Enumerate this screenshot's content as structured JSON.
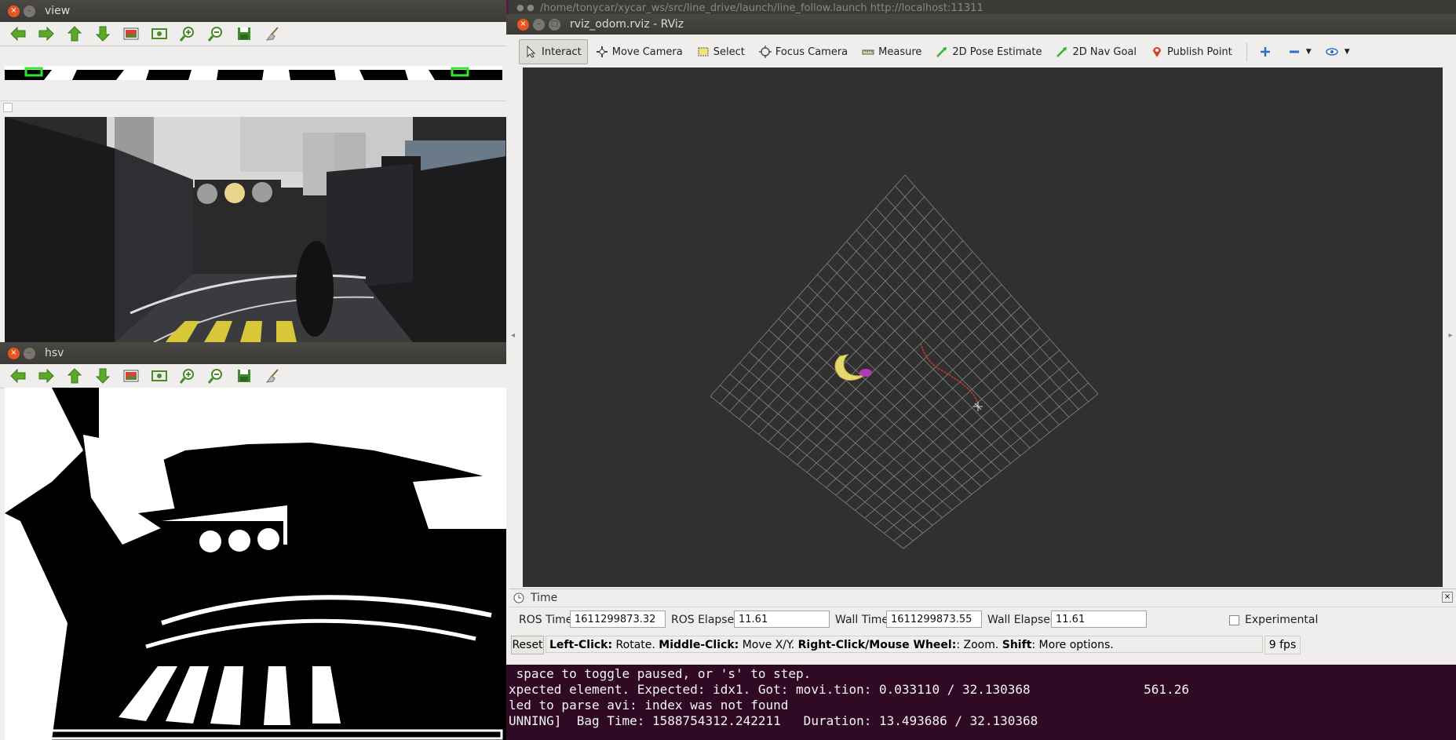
{
  "view_window": {
    "title": "view",
    "toolbar_icons": [
      "arrow-left-icon",
      "arrow-right-icon",
      "arrow-up-icon",
      "arrow-down-icon",
      "image-icon",
      "fit-window-icon",
      "zoom-in-icon",
      "zoom-out-icon",
      "save-icon",
      "clear-icon"
    ]
  },
  "hsv_window": {
    "title": "hsv",
    "toolbar_icons": [
      "arrow-left-icon",
      "arrow-right-icon",
      "arrow-up-icon",
      "arrow-down-icon",
      "image-icon",
      "fit-window-icon",
      "zoom-in-icon",
      "zoom-out-icon",
      "save-icon",
      "clear-icon"
    ]
  },
  "background_window": {
    "title": "/home/tonycar/xycar_ws/src/line_drive/launch/line_follow.launch http://localhost:11311"
  },
  "rviz": {
    "title": "rviz_odom.rviz - RViz",
    "tools": [
      {
        "label": "Interact",
        "icon": "cursor-icon",
        "active": true
      },
      {
        "label": "Move Camera",
        "icon": "move-camera-icon",
        "active": false
      },
      {
        "label": "Select",
        "icon": "select-icon",
        "active": false
      },
      {
        "label": "Focus Camera",
        "icon": "focus-camera-icon",
        "active": false
      },
      {
        "label": "Measure",
        "icon": "measure-icon",
        "active": false
      },
      {
        "label": "2D Pose Estimate",
        "icon": "pose-estimate-icon",
        "active": false
      },
      {
        "label": "2D Nav Goal",
        "icon": "nav-goal-icon",
        "active": false
      },
      {
        "label": "Publish Point",
        "icon": "publish-point-icon",
        "active": false
      }
    ],
    "time_panel": {
      "title": "Time",
      "ros_time_label": "ROS Time:",
      "ros_time": "1611299873.32",
      "ros_elapsed_label": "ROS Elapsed:",
      "ros_elapsed": "11.61",
      "wall_time_label": "Wall Time:",
      "wall_time": "1611299873.55",
      "wall_elapsed_label": "Wall Elapsed:",
      "wall_elapsed": "11.61",
      "experimental_label": "Experimental"
    },
    "status": {
      "reset_label": "Reset",
      "left_click_b": "Left-Click:",
      "left_click_t": " Rotate. ",
      "middle_click_b": "Middle-Click:",
      "middle_click_t": " Move X/Y. ",
      "right_click_b": "Right-Click/Mouse Wheel:",
      "right_click_t": ": Zoom. ",
      "shift_b": "Shift",
      "shift_t": ": More options.",
      "fps": "9 fps"
    }
  },
  "terminal": {
    "lines": [
      " space to toggle paused, or 's' to step.",
      "xpected element. Expected: idx1. Got: movi.tion: 0.033110 / 32.130368               561.26",
      "led to parse avi: index was not found",
      "UNNING]  Bag Time: 1588754312.242211   Duration: 13.493686 / 32.130368"
    ]
  },
  "colors": {
    "ubuntu_orange": "#e95420",
    "rviz_bg": "#303030",
    "grid": "#a0a0a0",
    "terminal_bg": "#300a24"
  }
}
